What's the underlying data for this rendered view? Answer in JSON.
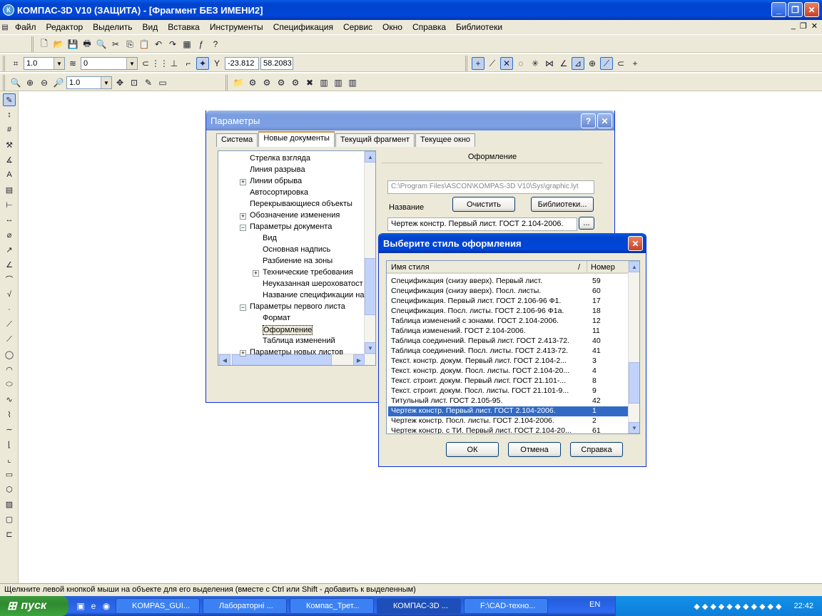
{
  "app": {
    "title": "КОМПАС-3D V10 (ЗАЩИТА) - [Фрагмент БЕЗ ИМЕНИ2]",
    "logo": "К"
  },
  "menu": [
    "Файл",
    "Редактор",
    "Выделить",
    "Вид",
    "Вставка",
    "Инструменты",
    "Спецификация",
    "Сервис",
    "Окно",
    "Справка",
    "Библиотеки"
  ],
  "toolbar": {
    "line_style": "1.0",
    "layer": "0",
    "coord_x": "-23.812",
    "coord_y": "58.2083",
    "zoom": "1.0"
  },
  "params_dialog": {
    "title": "Параметры",
    "tabs": [
      "Система",
      "Новые документы",
      "Текущий фрагмент",
      "Текущее окно"
    ],
    "tree": [
      {
        "label": "Стрелка взгляда",
        "level": 1,
        "expand": ""
      },
      {
        "label": "Линия разрыва",
        "level": 1,
        "expand": ""
      },
      {
        "label": "Линии обрыва",
        "level": 1,
        "expand": "+"
      },
      {
        "label": "Автосортировка",
        "level": 1,
        "expand": ""
      },
      {
        "label": "Перекрывающиеся объекты",
        "level": 1,
        "expand": ""
      },
      {
        "label": "Обозначение изменения",
        "level": 1,
        "expand": "+"
      },
      {
        "label": "Параметры документа",
        "level": 1,
        "expand": "-"
      },
      {
        "label": "Вид",
        "level": 2,
        "expand": ""
      },
      {
        "label": "Основная надпись",
        "level": 2,
        "expand": ""
      },
      {
        "label": "Разбиение на зоны",
        "level": 2,
        "expand": ""
      },
      {
        "label": "Технические требования",
        "level": 2,
        "expand": "+"
      },
      {
        "label": "Неуказанная шероховатост",
        "level": 2,
        "expand": ""
      },
      {
        "label": "Название спецификации на",
        "level": 2,
        "expand": ""
      },
      {
        "label": "Параметры первого листа",
        "level": 1,
        "expand": "-"
      },
      {
        "label": "Формат",
        "level": 2,
        "expand": ""
      },
      {
        "label": "Оформление",
        "level": 2,
        "expand": ""
      },
      {
        "label": "Таблица изменений",
        "level": 2,
        "expand": ""
      },
      {
        "label": "Параметры новых листов",
        "level": 1,
        "expand": "+"
      }
    ],
    "section_header": "Оформление",
    "path": "C:\\Program Files\\ASCON\\KOMPAS-3D V10\\Sys\\graphic.lyt",
    "name_label": "Название",
    "clear_button": "Очистить",
    "libraries_button": "Библиотеки...",
    "selected_style": "Чертеж констр. Первый лист. ГОСТ 2.104-2006.",
    "browse_button": "..."
  },
  "style_dialog": {
    "title": "Выберите стиль оформления",
    "col_name": "Имя стиля",
    "col_sort": "/",
    "col_number": "Номер",
    "rows": [
      {
        "name": "Спецификация (снизу вверх). Первый лист.",
        "num": "59"
      },
      {
        "name": "Спецификация (снизу вверх). Посл. листы.",
        "num": "60"
      },
      {
        "name": "Спецификация. Первый лист. ГОСТ 2.106-96 Ф1.",
        "num": "17"
      },
      {
        "name": "Спецификация. Посл. листы. ГОСТ 2.106-96 Ф1а.",
        "num": "18"
      },
      {
        "name": "Таблица изменений с зонами. ГОСТ 2.104-2006.",
        "num": "12"
      },
      {
        "name": "Таблица изменений. ГОСТ 2.104-2006.",
        "num": "11"
      },
      {
        "name": "Таблица соединений. Первый лист. ГОСТ 2.413-72.",
        "num": "40"
      },
      {
        "name": "Таблица соединений. Посл. листы. ГОСТ 2.413-72.",
        "num": "41"
      },
      {
        "name": "Текст. констр. докум. Первый лист. ГОСТ 2.104-2...",
        "num": "3"
      },
      {
        "name": "Текст. констр. докум. Посл. листы. ГОСТ 2.104-20...",
        "num": "4"
      },
      {
        "name": "Текст. строит. докум. Первый лист. ГОСТ 21.101-...",
        "num": "8"
      },
      {
        "name": "Текст. строит. докум. Посл. листы. ГОСТ 21.101-9...",
        "num": "9"
      },
      {
        "name": "Титульный лист. ГОСТ 2.105-95.",
        "num": "42"
      },
      {
        "name": "Чертеж констр. Первый лист. ГОСТ 2.104-2006.",
        "num": "1",
        "selected": true
      },
      {
        "name": "Чертеж констр. Посл. листы. ГОСТ 2.104-2006.",
        "num": "2"
      },
      {
        "name": "Чертеж констр. с ТИ. Первый лист. ГОСТ 2.104-20...",
        "num": "61"
      }
    ],
    "ok": "ОК",
    "cancel": "Отмена",
    "help": "Справка"
  },
  "status": "Щелкните левой кнопкой мыши на объекте для его выделения (вместе с Ctrl или Shift - добавить к выделенным)",
  "taskbar": {
    "start": "пуск",
    "tasks": [
      "KOMPAS_GUI...",
      "Лабораторні ...",
      "Компас_Трет...",
      "КОМПАС-3D ...",
      "F:\\CAD-техно..."
    ],
    "lang": "EN",
    "clock": "22:42"
  }
}
